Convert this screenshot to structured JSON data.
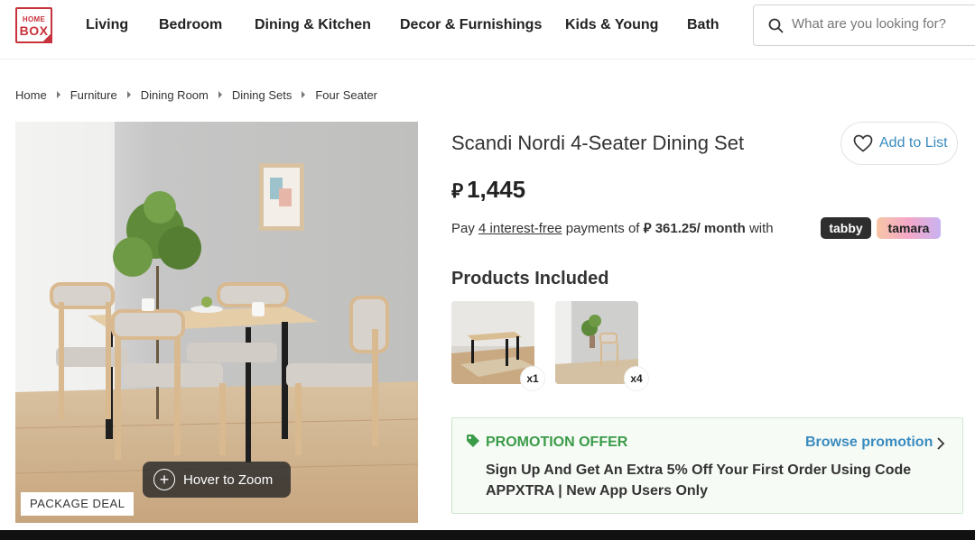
{
  "header": {
    "logo": {
      "line1": "HOME",
      "line2": "BOX"
    },
    "nav": [
      "Living",
      "Bedroom",
      "Dining & Kitchen",
      "Decor & Furnishings",
      "Kids & Young",
      "Bath"
    ],
    "search_placeholder": "What are you looking for?"
  },
  "breadcrumb": [
    "Home",
    "Furniture",
    "Dining Room",
    "Dining Sets",
    "Four Seater"
  ],
  "gallery": {
    "zoom_hint": "Hover to Zoom",
    "badge": "PACKAGE DEAL"
  },
  "product": {
    "title": "Scandi Nordi 4-Seater Dining Set",
    "wishlist_label": "Add to List",
    "currency_symbol": "⃁",
    "price": "1,445",
    "installments": {
      "prefix": "Pay",
      "link": "4 interest-free",
      "middle": "payments of",
      "amount": "⃁ 361.25/ month",
      "suffix": "with"
    },
    "providers": [
      "tabby",
      "tamara"
    ],
    "included_title": "Products Included",
    "included": [
      {
        "name": "dining-table",
        "qty": "x1"
      },
      {
        "name": "dining-chair",
        "qty": "x4"
      }
    ]
  },
  "promotion": {
    "label": "PROMOTION OFFER",
    "browse": "Browse promotion",
    "text": "Sign Up And Get An Extra 5% Off Your First Order Using Code APPXTRA | New App Users Only"
  },
  "colors": {
    "brand": "#c8323c",
    "link": "#3a8bbf",
    "promo_green": "#3a9b48"
  }
}
